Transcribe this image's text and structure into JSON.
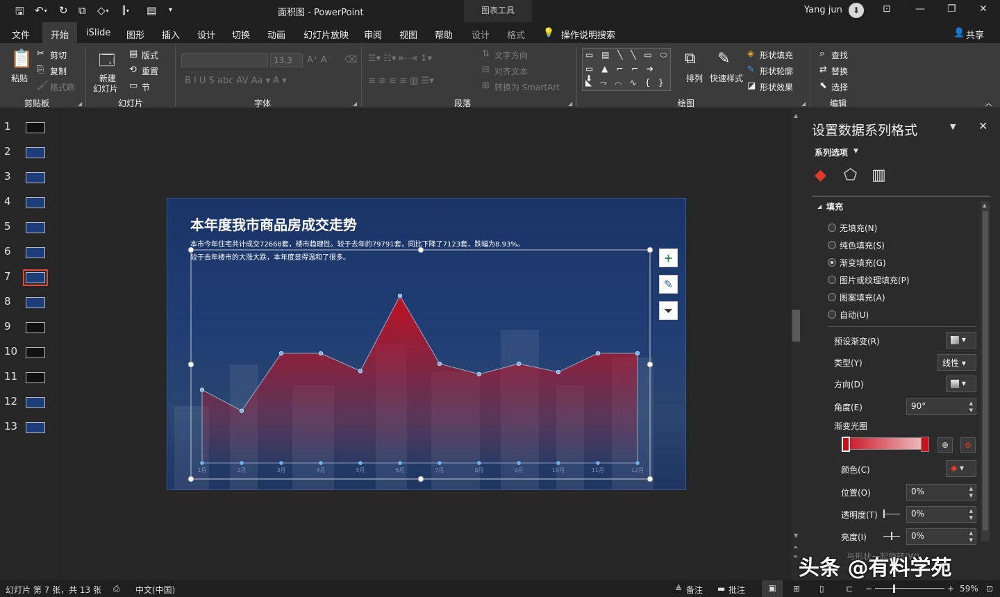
{
  "titlebar": {
    "doc_title": "面积图 - PowerPoint",
    "tools_title": "图表工具",
    "user": "Yang jun",
    "avatar": "⬇"
  },
  "tabs": [
    "文件",
    "开始",
    "iSlide",
    "图形",
    "插入",
    "设计",
    "切换",
    "动画",
    "幻灯片放映",
    "审阅",
    "视图",
    "帮助",
    "设计",
    "格式"
  ],
  "tell_me": "操作说明搜索",
  "share": "共享",
  "ribbon": {
    "paste": "粘贴",
    "cut": "剪切",
    "copy": "复制",
    "format_painter": "格式刷",
    "group_clipboard": "剪贴板",
    "new_slide_1": "新建",
    "new_slide_2": "幻灯片",
    "layout": "版式",
    "reset": "重置",
    "section": "节",
    "group_slides": "幻灯片",
    "font_size": "13.3",
    "group_font": "字体",
    "text_direction": "文字方向",
    "align_text": "对齐文本",
    "convert_smartart": "转换为 SmartArt",
    "group_paragraph": "段落",
    "arrange": "排列",
    "quick_styles": "快速样式",
    "shape_fill": "形状填充",
    "shape_outline": "形状轮廓",
    "shape_effects": "形状效果",
    "group_drawing": "绘图",
    "find": "查找",
    "replace": "替换",
    "select": "选择",
    "group_editing": "编辑"
  },
  "thumbnails": [
    "1",
    "2",
    "3",
    "4",
    "5",
    "6",
    "7",
    "8",
    "9",
    "10",
    "11",
    "12",
    "13"
  ],
  "slide": {
    "title": "本年度我市商品房成交走势",
    "body": "本市今年住宅共计成交72668套，楼市趋理性。较于去年的79791套，同比下降了7123套，跌幅为8.93%。较于去年楼市的大涨大跌，本年度显得温和了很多。"
  },
  "chart_data": {
    "type": "area",
    "categories": [
      "1月",
      "2月",
      "3月",
      "4月",
      "5月",
      "6月",
      "7月",
      "8月",
      "9月",
      "10月",
      "11月",
      "12月"
    ],
    "values": [
      7000,
      5000,
      10500,
      10500,
      8800,
      16000,
      9500,
      8500,
      9500,
      8700,
      10500,
      10500
    ],
    "ylim": [
      0,
      18000
    ],
    "grid": false,
    "legend": "none",
    "colors": {
      "top": "#c8101e",
      "bottom": "#c8101e",
      "line": "#9aa9c8",
      "point": "#6fb3f0"
    }
  },
  "chart_buttons": {
    "add": "+",
    "style": "✎",
    "filter": "⏷"
  },
  "pane": {
    "title": "设置数据系列格式",
    "series_options": "系列选项",
    "section_fill": "填充",
    "fill_options": [
      "无填充(N)",
      "纯色填充(S)",
      "渐变填充(G)",
      "图片或纹理填充(P)",
      "图案填充(A)",
      "自动(U)"
    ],
    "selected_fill": "渐变填充(G)",
    "preset_gradient": "预设渐变(R)",
    "type_label": "类型(Y)",
    "type_value": "线性",
    "direction": "方向(D)",
    "angle_label": "角度(E)",
    "angle_value": "90°",
    "gradient_stops": "渐变光圈",
    "color_label": "颜色(C)",
    "position_label": "位置(O)",
    "position_value": "0%",
    "transparency_label": "透明度(T)",
    "transparency_value": "0%",
    "brightness_label": "亮度(I)",
    "brightness_value": "0%",
    "partial": "与形状一起旋转(W)"
  },
  "status": {
    "slide_info": "幻灯片 第 7 张，共 13 张",
    "language": "中文(中国)",
    "notes": "备注",
    "comments": "批注",
    "zoom": "59%"
  },
  "watermark": "头条 @有料学苑"
}
